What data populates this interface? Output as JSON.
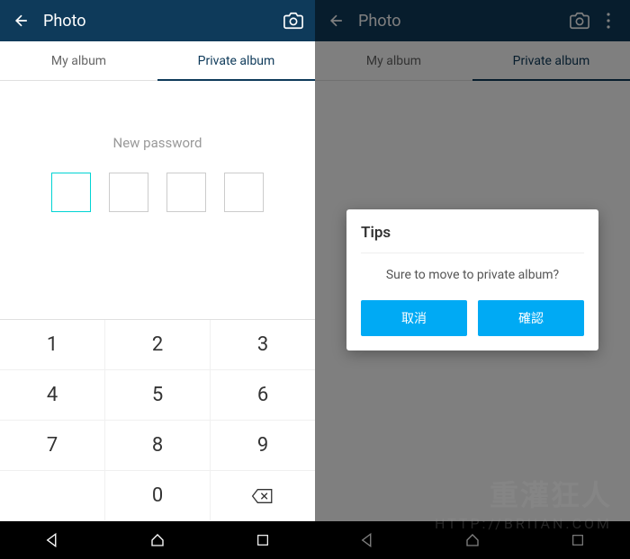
{
  "left": {
    "header": {
      "title": "Photo"
    },
    "tabs": {
      "my_album": "My album",
      "private_album": "Private album"
    },
    "prompt": "New password",
    "keypad": {
      "r1": [
        "1",
        "2",
        "3"
      ],
      "r2": [
        "4",
        "5",
        "6"
      ],
      "r3": [
        "7",
        "8",
        "9"
      ],
      "r4": [
        "",
        "0",
        "⌫"
      ]
    }
  },
  "right": {
    "header": {
      "title": "Photo"
    },
    "tabs": {
      "my_album": "My album",
      "private_album": "Private album"
    },
    "dialog": {
      "title": "Tips",
      "message": "Sure to move to private album?",
      "cancel": "取消",
      "confirm": "確認"
    }
  },
  "watermark": {
    "main": "重灌狂人",
    "sub": "HTTP://BRIIAN.COM"
  }
}
